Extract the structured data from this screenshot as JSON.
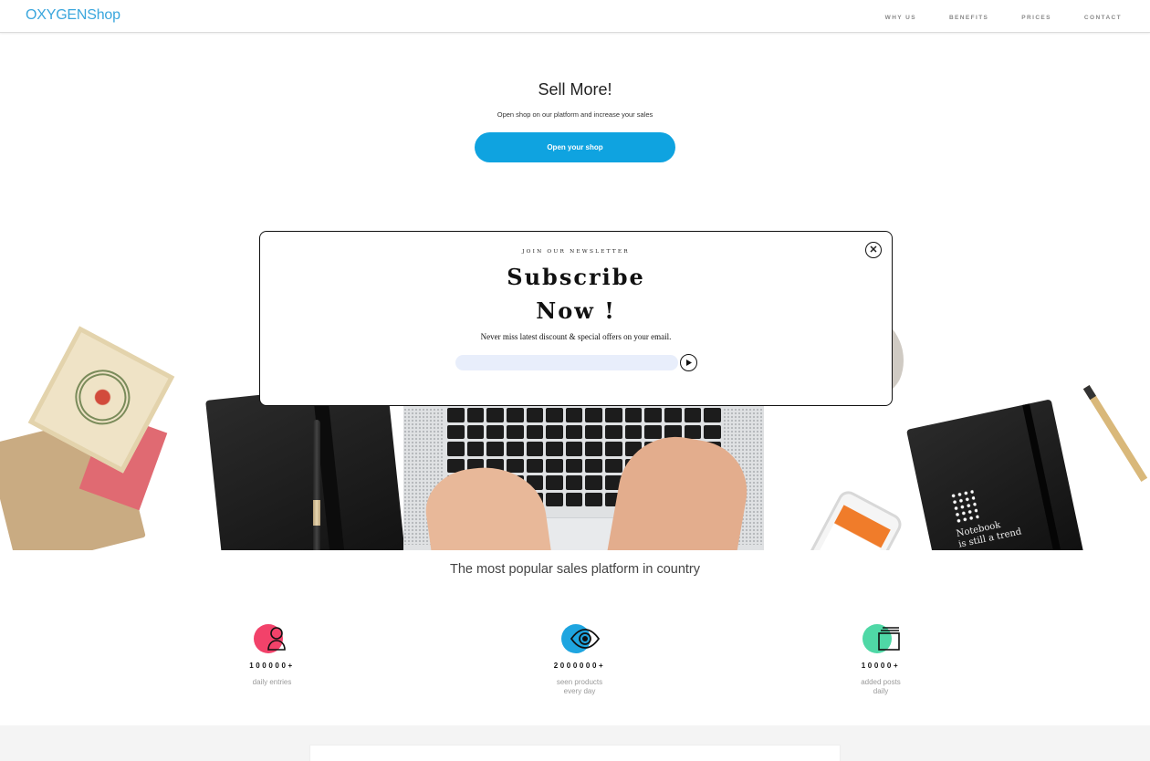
{
  "header": {
    "brand": "OXYGENShop",
    "nav": [
      "WHY US",
      "BENEFITS",
      "PRICES",
      "CONTACT"
    ]
  },
  "hero": {
    "title": "Sell More!",
    "subtitle": "Open shop on our platform and increase your sales",
    "cta_label": "Open your shop"
  },
  "desk_image": {
    "notebook_text": "Notebook\nis still a trend"
  },
  "tagline": "The most popular sales platform in country",
  "stats": [
    {
      "icon": "user-icon",
      "color": "#f2426a",
      "value": "100000+",
      "label": "daily entries"
    },
    {
      "icon": "eye-icon",
      "color": "#1ea5e0",
      "value": "2000000+",
      "label": "seen products\nevery day"
    },
    {
      "icon": "posts-icon",
      "color": "#4fd8a6",
      "value": "10000+",
      "label": "added posts\ndaily"
    }
  ],
  "modal": {
    "kicker": "JOIN OUR NEWSLETTER",
    "title_line1": "Subscribe",
    "title_line2": "Now !",
    "description": "Never miss latest discount & special offers on your email.",
    "email_value": "",
    "email_placeholder": ""
  },
  "colors": {
    "brand": "#3aa6dd",
    "cta": "#0fa3e0",
    "input_bg": "#e8eefb"
  }
}
